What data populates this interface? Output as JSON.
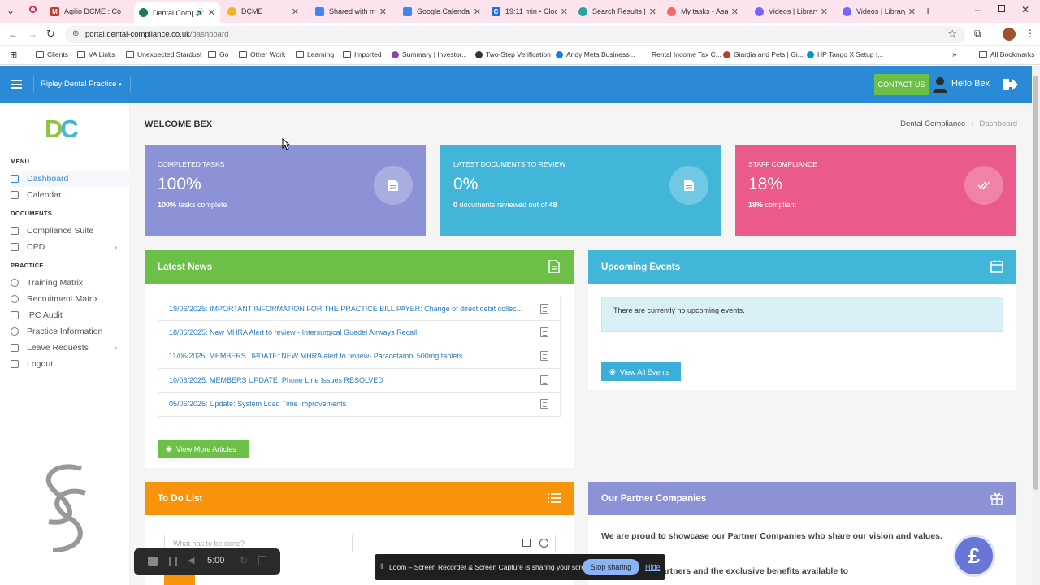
{
  "browser": {
    "tabs": [
      {
        "title": "Agilio DCME : Co",
        "color": "#c0392b"
      },
      {
        "title": "Dental Comp",
        "color": "#1e7a5e",
        "active": true
      },
      {
        "title": "DCME",
        "color": "#f0b429"
      },
      {
        "title": "Shared with me",
        "color": "#4285f4"
      },
      {
        "title": "Google Calendar",
        "color": "#4285f4"
      },
      {
        "title": "19:11 min • Clock",
        "color": "#1a73e8"
      },
      {
        "title": "Search Results |",
        "color": "#26a69a"
      },
      {
        "title": "My tasks - Asana",
        "color": "#f06a6a"
      },
      {
        "title": "Videos | Library",
        "color": "#7b61ff"
      },
      {
        "title": "Videos | Library",
        "color": "#7b61ff"
      }
    ],
    "url_host": "portal.dental-compliance.co.uk",
    "url_path": "/dashboard",
    "bookmarks": [
      "Clients",
      "VA Links",
      "Unexpected Stardust",
      "Go",
      "Other Work",
      "Learning",
      "Imported",
      "Summary | Investor...",
      "Two-Step Verification",
      "Andy Meta Business...",
      "Rental Income Tax C...",
      "Giardia and Pets | Gi...",
      "HP Tango X Setup |...",
      "All Bookmarks"
    ]
  },
  "header": {
    "practice": "Ripley Dental Practice",
    "contact_label": "CONTACT US",
    "greeting": "Hello Bex"
  },
  "sidebar": {
    "logo_d": "D",
    "logo_c": "C",
    "sections": [
      "MENU",
      "DOCUMENTS",
      "PRACTICE"
    ],
    "items": [
      "Dashboard",
      "Calendar",
      "Compliance Suite",
      "CPD",
      "Training Matrix",
      "Recruitment Matrix",
      "IPC Audit",
      "Practice Information",
      "Leave Requests",
      "Logout"
    ]
  },
  "main": {
    "welcome": "WELCOME BEX",
    "breadcrumb": [
      "Dental Compliance",
      "Dashboard"
    ],
    "stats": [
      {
        "label": "COMPLETED TASKS",
        "value": "100%",
        "sub_bold": "100%",
        "sub": " tasks complete",
        "color": "#8b93d6"
      },
      {
        "label": "LATEST DOCUMENTS TO REVIEW",
        "value": "0%",
        "sub_bold": "0",
        "sub": " documents reviewed out of ",
        "sub_bold2": "48",
        "color": "#41b6d9"
      },
      {
        "label": "STAFF COMPLIANCE",
        "value": "18%",
        "sub_bold": "18%",
        "sub": " compliant",
        "color": "#ea5a8a"
      }
    ],
    "news": {
      "title": "Latest News",
      "items": [
        "19/06/2025: IMPORTANT INFORMATION FOR THE PRACTICE BILL PAYER: Change of direct debit collec...",
        "18/06/2025: New MHRA Alert to review - Intersurgical Guedel Airways Recall",
        "11/06/2025: MEMBERS UPDATE: NEW MHRA alert to review- Paracetamol 500mg tablets",
        "10/06/2025: MEMBERS UPDATE: Phone Line Issues RESOLVED",
        "05/06/2025: Update: System Load Time Improvements"
      ],
      "button": "View More Articles"
    },
    "events": {
      "title": "Upcoming Events",
      "empty": "There are currently no upcoming events.",
      "button": "View All Events"
    },
    "todo": {
      "title": "To Do List",
      "placeholder": "What has to be done?"
    },
    "partners": {
      "title": "Our Partner Companies",
      "text1": "We are proud to showcase our Partner Companies who share our vision and values.",
      "text2": "d a list of the Partners and the exclusive benefits available to",
      "badge": "£"
    }
  },
  "loom": {
    "time": "5:00",
    "share_text": "Loom – Screen Recorder & Screen Capture is sharing your screen.",
    "stop": "Stop sharing",
    "hide": "Hide"
  }
}
